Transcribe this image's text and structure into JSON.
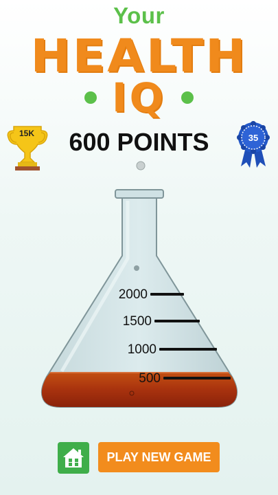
{
  "title": {
    "line1": "Your",
    "line2": "HEALTH",
    "line3": "IQ"
  },
  "trophy": {
    "label": "15K",
    "icon": "trophy-icon"
  },
  "score": {
    "text": "600 POINTS"
  },
  "ribbon": {
    "label": "35",
    "icon": "ribbon-icon"
  },
  "flask": {
    "marks": [
      "2000",
      "1500",
      "1000",
      "500"
    ],
    "fill_level": 600,
    "liquid_color": "#a8320e"
  },
  "buttons": {
    "home_icon": "home-icon",
    "play_label": "PLAY NEW GAME"
  },
  "colors": {
    "green": "#5cc04a",
    "orange": "#f08a1c",
    "home_green": "#3fae4a"
  }
}
